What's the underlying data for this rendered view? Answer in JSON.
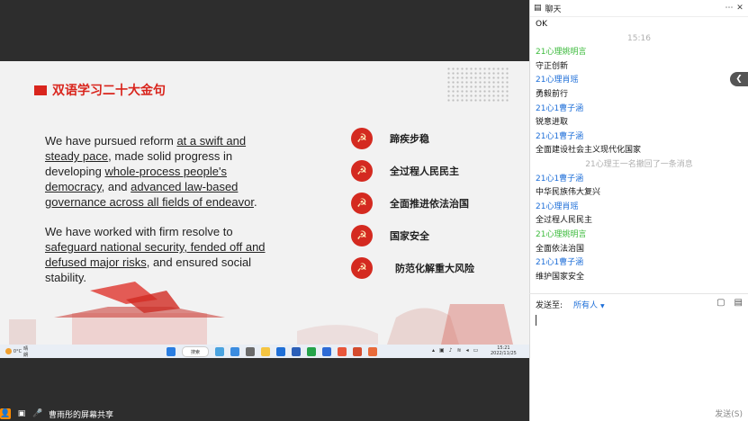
{
  "slide": {
    "title": "双语学习二十大金句",
    "para1": {
      "t1": "We have pursued reform ",
      "u1": "at a swift and steady pace",
      "t2": ", made solid progress in developing ",
      "u2": "whole-process people's democracy",
      "t3": ", and ",
      "u3": "advanced law-based governance across all fields of endeavor",
      "t4": "."
    },
    "para2": {
      "t1": "We have worked with firm resolve to ",
      "u1": "safeguard national security, fended off and defused major risks",
      "t2": ", and ensured social stability."
    },
    "items": [
      "蹄疾步稳",
      "全过程人民民主",
      "全面推进依法治国",
      "国家安全",
      "防范化解重大风险"
    ]
  },
  "taskbar": {
    "weather_temp": "0°C",
    "weather_label": "晴朗",
    "search": "搜索",
    "time": "15:21",
    "date": "2022/11/25"
  },
  "share_status": {
    "text": "曹雨彤的屏幕共享"
  },
  "chat": {
    "title": "聊天",
    "messages": [
      {
        "type": "text",
        "text": "OK"
      },
      {
        "type": "system",
        "text": "15:16"
      },
      {
        "type": "green",
        "text": "21心理姚明言"
      },
      {
        "type": "text",
        "text": "守正创新"
      },
      {
        "type": "blue",
        "text": "21心理肖瑶"
      },
      {
        "type": "text",
        "text": "勇毅前行"
      },
      {
        "type": "blue",
        "text": "21心1曹子涵"
      },
      {
        "type": "text",
        "text": "锐意进取"
      },
      {
        "type": "blue",
        "text": "21心1曹子涵"
      },
      {
        "type": "text",
        "text": "全面建设社会主义现代化国家"
      },
      {
        "type": "system",
        "text": "21心理王一名撤回了一条消息"
      },
      {
        "type": "blue",
        "text": "21心1曹子涵"
      },
      {
        "type": "text",
        "text": "中华民族伟大复兴"
      },
      {
        "type": "blue",
        "text": "21心理肖瑶"
      },
      {
        "type": "text",
        "text": "全过程人民民主"
      },
      {
        "type": "green",
        "text": "21心理姚明言"
      },
      {
        "type": "text",
        "text": "全面依法治国"
      },
      {
        "type": "blue",
        "text": "21心1曹子涵"
      },
      {
        "type": "text",
        "text": "维护国家安全"
      }
    ],
    "send_to_label": "发送至:",
    "send_to_value": "所有人",
    "send_button": "发送(S)"
  },
  "colors": {
    "red": "#d9251d",
    "green": "#3dbb3d",
    "blue": "#1d6ed8"
  }
}
